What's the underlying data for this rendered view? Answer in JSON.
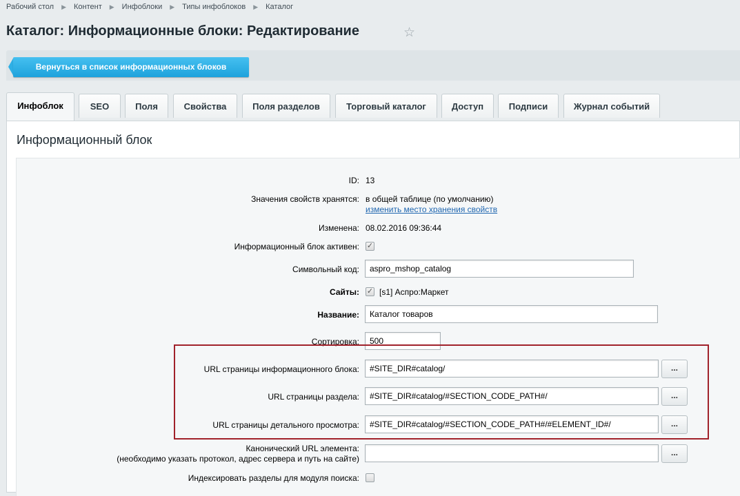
{
  "breadcrumb": [
    "Рабочий стол",
    "Контент",
    "Инфоблоки",
    "Типы инфоблоков",
    "Каталог"
  ],
  "page_title": "Каталог: Информационные блоки: Редактирование",
  "star_icon": "☆",
  "back_button": "Вернуться в список информационных блоков",
  "tabs": [
    "Инфоблок",
    "SEO",
    "Поля",
    "Свойства",
    "Поля разделов",
    "Торговый каталог",
    "Доступ",
    "Подписи",
    "Журнал событий"
  ],
  "section_title": "Информационный блок",
  "form": {
    "id_label": "ID:",
    "id_value": "13",
    "storage_label": "Значения свойств хранятся:",
    "storage_value": "в общей таблице (по умолчанию)",
    "storage_link": "изменить место хранения свойств",
    "changed_label": "Изменена:",
    "changed_value": "08.02.2016 09:36:44",
    "active_label": "Информационный блок активен:",
    "code_label": "Символьный код:",
    "code_value": "aspro_mshop_catalog",
    "sites_label": "Сайты:",
    "sites_value": "[s1] Аспро:Маркет",
    "name_label": "Название:",
    "name_value": "Каталог товаров",
    "sort_label": "Сортировка:",
    "sort_value": "500",
    "url_list_label": "URL страницы информационного блока:",
    "url_list_value": "#SITE_DIR#catalog/",
    "url_section_label": "URL страницы раздела:",
    "url_section_value": "#SITE_DIR#catalog/#SECTION_CODE_PATH#/",
    "url_detail_label": "URL страницы детального просмотра:",
    "url_detail_value": "#SITE_DIR#catalog/#SECTION_CODE_PATH#/#ELEMENT_ID#/",
    "canonical_label_1": "Канонический URL элемента:",
    "canonical_label_2": "(необходимо указать протокол, адрес сервера и путь на сайте)",
    "canonical_value": "",
    "index_label": "Индексировать разделы для модуля поиска:",
    "dots_label": "...",
    "check_mark": "✓"
  }
}
